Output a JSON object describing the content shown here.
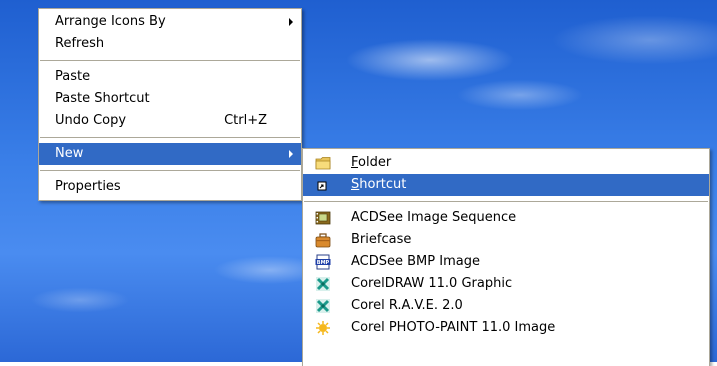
{
  "context_menu": {
    "items": [
      {
        "label": "Arrange Icons By"
      },
      {
        "label": "Refresh"
      },
      {
        "label": "Paste"
      },
      {
        "label": "Paste Shortcut"
      },
      {
        "label": "Undo Copy",
        "shortcut": "Ctrl+Z"
      },
      {
        "label": "New"
      },
      {
        "label": "Properties"
      }
    ]
  },
  "new_submenu": {
    "items": [
      {
        "hotkey": "F",
        "rest": "older",
        "icon": "folder-icon"
      },
      {
        "hotkey": "S",
        "rest": "hortcut",
        "icon": "shortcut-icon"
      },
      {
        "label": "ACDSee Image Sequence",
        "icon": "acdsee-sequence-icon"
      },
      {
        "label": "Briefcase",
        "icon": "briefcase-icon"
      },
      {
        "label": "ACDSee BMP Image",
        "icon": "bmp-icon"
      },
      {
        "label": "CorelDRAW 11.0 Graphic",
        "icon": "coreldraw-icon"
      },
      {
        "label": "Corel R.A.V.E. 2.0",
        "icon": "corel-rave-icon"
      },
      {
        "label": "Corel PHOTO-PAINT 11.0 Image",
        "icon": "corel-photopaint-icon"
      }
    ]
  },
  "colors": {
    "highlight": "#316ac5",
    "menu_background": "#ffffff",
    "desktop_blue": "#3a7fe8"
  }
}
